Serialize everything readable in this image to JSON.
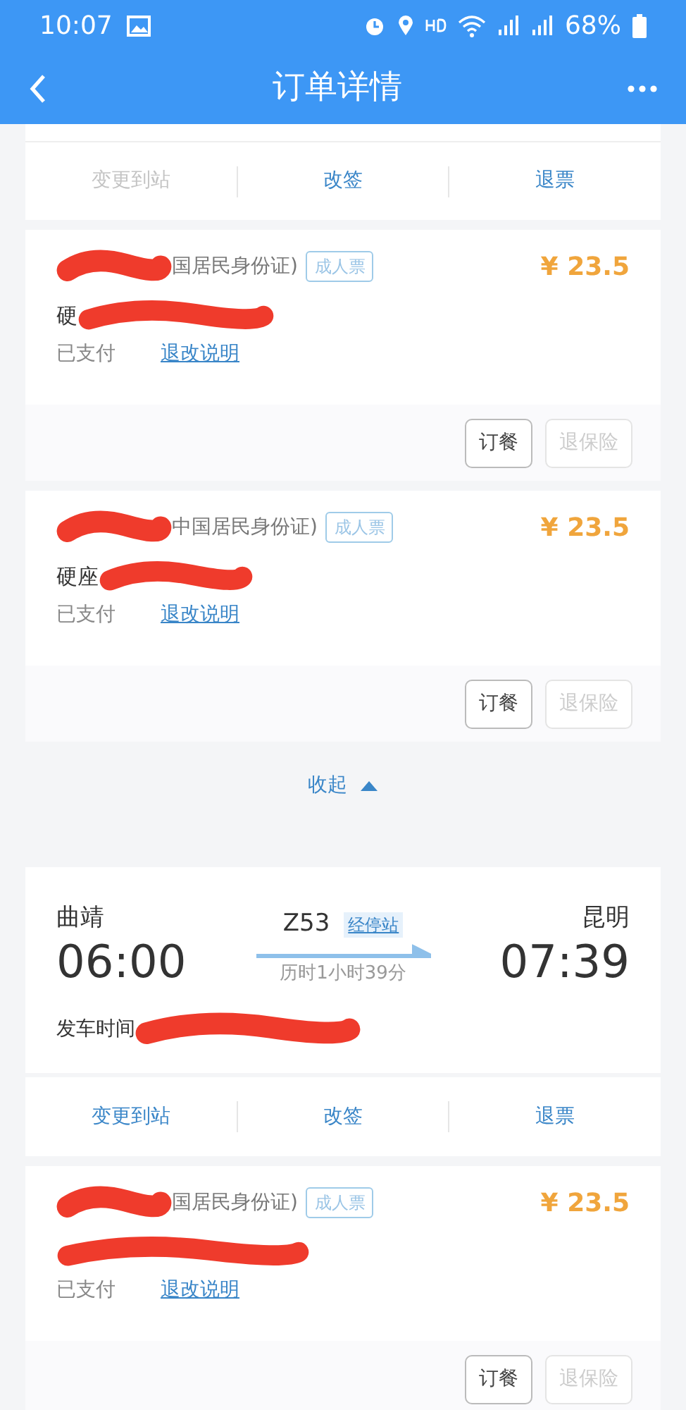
{
  "status_bar": {
    "time": "10:07",
    "battery": "68%"
  },
  "header": {
    "title": "订单详情"
  },
  "top_actions": [
    {
      "label": "变更到站",
      "disabled": true
    },
    {
      "label": "改签",
      "disabled": false
    },
    {
      "label": "退票",
      "disabled": false
    }
  ],
  "passengers": [
    {
      "id_type": "国居民身份证)",
      "badge": "成人票",
      "price": "¥ 23.5",
      "seat": "硬",
      "status": "已支付",
      "link": "退改说明",
      "buttons": [
        {
          "label": "订餐",
          "disabled": false
        },
        {
          "label": "退保险",
          "disabled": true
        }
      ]
    },
    {
      "id_type": "中国居民身份证)",
      "badge": "成人票",
      "price": "¥ 23.5",
      "seat": "硬座",
      "status": "已支付",
      "link": "退改说明",
      "buttons": [
        {
          "label": "订餐",
          "disabled": false
        },
        {
          "label": "退保险",
          "disabled": true
        }
      ]
    }
  ],
  "collapse": {
    "label": "收起"
  },
  "trip": {
    "from": "曲靖",
    "depart": "06:00",
    "train": "Z53",
    "stops": "经停站",
    "duration": "历时1小时39分",
    "to": "昆明",
    "arrive": "07:39",
    "depart_label": "发车时间"
  },
  "trip_actions": [
    {
      "label": "变更到站",
      "disabled": false
    },
    {
      "label": "改签",
      "disabled": false
    },
    {
      "label": "退票",
      "disabled": false
    }
  ],
  "trip_passengers": [
    {
      "id_type": "国居民身份证)",
      "badge": "成人票",
      "price": "¥ 23.5",
      "status": "已支付",
      "link": "退改说明",
      "buttons": [
        {
          "label": "订餐",
          "disabled": false
        },
        {
          "label": "退保险",
          "disabled": true
        }
      ]
    }
  ]
}
